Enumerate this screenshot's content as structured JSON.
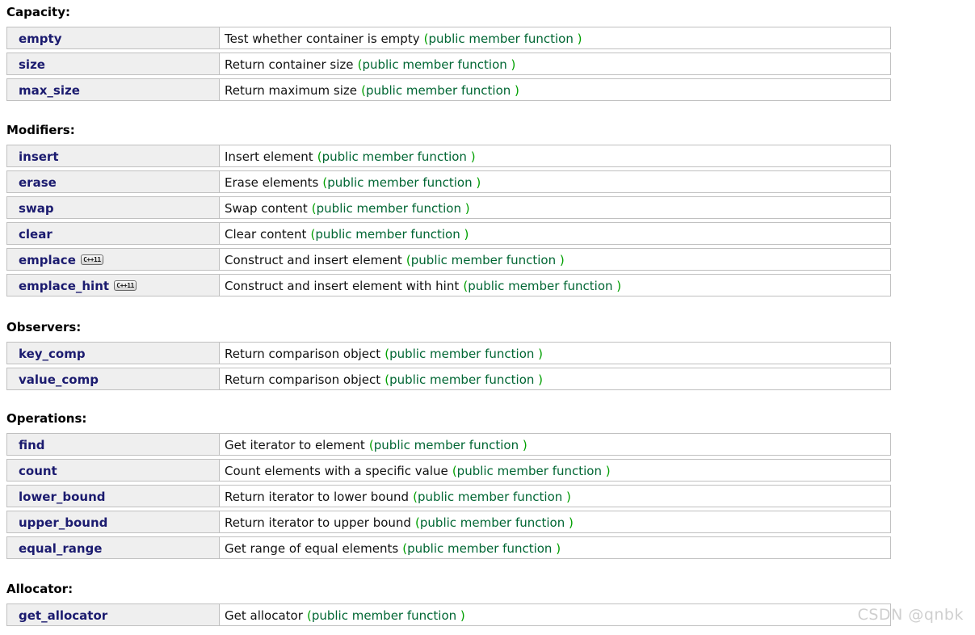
{
  "watermark": "CSDN @qnbk",
  "badge": {
    "label": "C++11"
  },
  "colors": {
    "member_link": "#1b1b6f",
    "kind_text": "#006633",
    "paren": "#00a000",
    "name_cell_bg": "#efefef",
    "border": "#c0c0c0",
    "watermark": "#cfcfcf"
  },
  "sections": [
    {
      "heading": "Capacity",
      "colon": ":",
      "rows": [
        {
          "name": "empty",
          "badge": false,
          "desc": "Test whether container is empty",
          "kind": "public member function"
        },
        {
          "name": "size",
          "badge": false,
          "desc": "Return container size",
          "kind": "public member function"
        },
        {
          "name": "max_size",
          "badge": false,
          "desc": "Return maximum size",
          "kind": "public member function"
        }
      ]
    },
    {
      "heading": "Modifiers",
      "colon": ":",
      "rows": [
        {
          "name": "insert",
          "badge": false,
          "desc": "Insert element",
          "kind": "public member function"
        },
        {
          "name": "erase",
          "badge": false,
          "desc": "Erase elements",
          "kind": "public member function"
        },
        {
          "name": "swap",
          "badge": false,
          "desc": "Swap content",
          "kind": "public member function"
        },
        {
          "name": "clear",
          "badge": false,
          "desc": "Clear content",
          "kind": "public member function"
        },
        {
          "name": "emplace",
          "badge": true,
          "desc": "Construct and insert element",
          "kind": "public member function"
        },
        {
          "name": "emplace_hint",
          "badge": true,
          "desc": "Construct and insert element with hint",
          "kind": "public member function"
        }
      ]
    },
    {
      "heading": "Observers",
      "colon": ":",
      "rows": [
        {
          "name": "key_comp",
          "badge": false,
          "desc": "Return comparison object",
          "kind": "public member function"
        },
        {
          "name": "value_comp",
          "badge": false,
          "desc": "Return comparison object",
          "kind": "public member function"
        }
      ]
    },
    {
      "heading": "Operations",
      "colon": ":",
      "rows": [
        {
          "name": "find",
          "badge": false,
          "desc": "Get iterator to element",
          "kind": "public member function"
        },
        {
          "name": "count",
          "badge": false,
          "desc": "Count elements with a specific value",
          "kind": "public member function"
        },
        {
          "name": "lower_bound",
          "badge": false,
          "desc": "Return iterator to lower bound",
          "kind": "public member function"
        },
        {
          "name": "upper_bound",
          "badge": false,
          "desc": "Return iterator to upper bound",
          "kind": "public member function"
        },
        {
          "name": "equal_range",
          "badge": false,
          "desc": "Get range of equal elements",
          "kind": "public member function"
        }
      ]
    },
    {
      "heading": "Allocator",
      "colon": ":",
      "rows": [
        {
          "name": "get_allocator",
          "badge": false,
          "desc": "Get allocator",
          "kind": "public member function"
        }
      ]
    }
  ]
}
